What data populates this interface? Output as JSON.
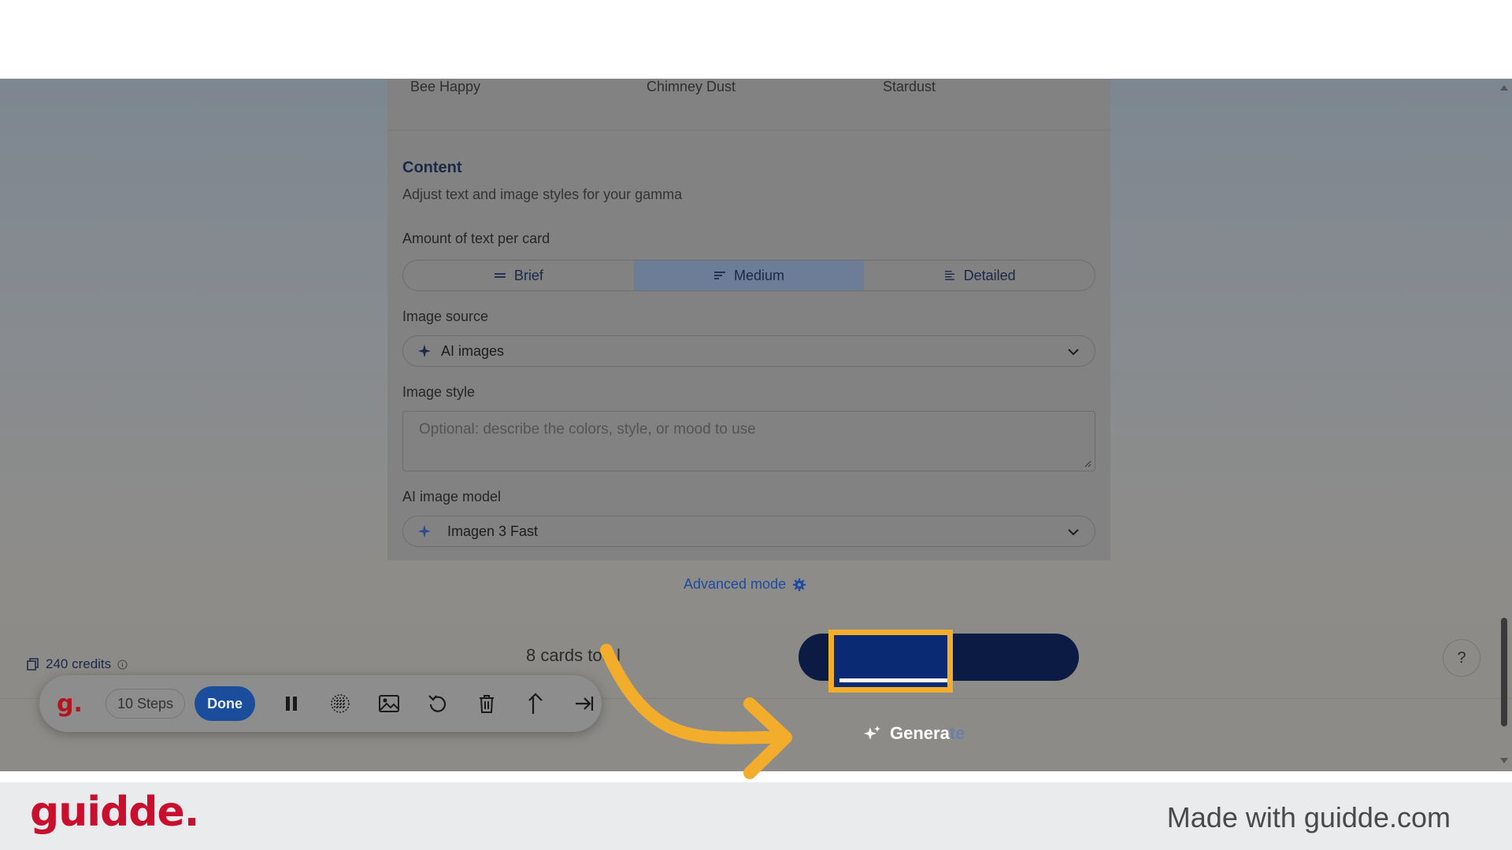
{
  "themes": [
    "Bee Happy",
    "Chimney Dust",
    "Stardust"
  ],
  "content_section": {
    "title": "Content",
    "subtitle": "Adjust text and image styles for your gamma"
  },
  "text_amount": {
    "label": "Amount of text per card",
    "options": [
      "Brief",
      "Medium",
      "Detailed"
    ],
    "selected": "Medium"
  },
  "image_source": {
    "label": "Image source",
    "value": "AI images"
  },
  "image_style": {
    "label": "Image style",
    "placeholder": "Optional: describe the colors, style, or mood to use"
  },
  "ai_image_model": {
    "label": "AI image model",
    "value": "Imagen 3 Fast"
  },
  "advanced_mode": "Advanced mode",
  "bottom_bar": {
    "credits": "240 credits",
    "cards_total": "8 cards total",
    "generate_visible": "Genera",
    "generate_hidden": "te",
    "help": "?"
  },
  "recorder_toolbar": {
    "logo": "g.",
    "steps": "10 Steps",
    "done": "Done",
    "icons": [
      "pause-icon",
      "blur-icon",
      "image-icon",
      "undo-icon",
      "trash-icon",
      "share-icon",
      "skip-icon"
    ]
  },
  "footer": {
    "brand": "guidde.",
    "made_with": "Made with guidde.com"
  },
  "colors": {
    "accent_highlight": "#f3ad2c",
    "generate_bg": "#0b1b44",
    "brand_red": "#c8102e"
  }
}
